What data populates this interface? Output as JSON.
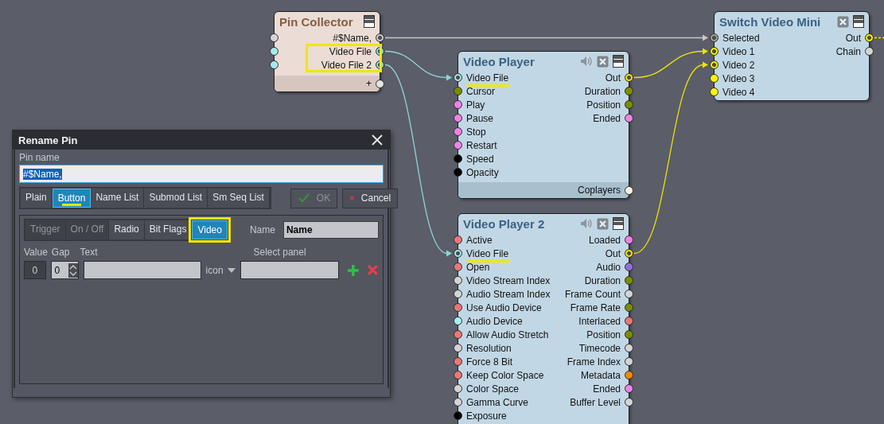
{
  "nodes": [
    {
      "kind": "collector",
      "title": "Pin Collector",
      "inputs": [
        {
          "color": "#d4d4d4",
          "connected": false
        },
        {
          "color": "#a4eaea",
          "connected": false
        },
        {
          "color": "#a4eaea",
          "connected": false
        }
      ],
      "outputs": [
        {
          "label": "#$Name,",
          "color": "#c8c8c8",
          "connected": true,
          "highlighted": false
        },
        {
          "label": "Video File",
          "color": "#8fd4d4",
          "connected": true,
          "highlighted": true
        },
        {
          "label": "Video File 2",
          "color": "#8fd4d4",
          "connected": true,
          "highlighted": true
        }
      ],
      "footer_outputs": [
        {
          "label": "+",
          "color": "#e4e4e4",
          "connected": false
        }
      ]
    },
    {
      "kind": "player",
      "title": "Video Player",
      "inputs": [
        {
          "label": "Video File",
          "color": "#a4e4e4",
          "connected": true,
          "highlighted": true
        },
        {
          "label": "Cursor",
          "color": "#7a8c00",
          "connected": false
        },
        {
          "label": "Play",
          "color": "#ee82e8",
          "connected": false
        },
        {
          "label": "Pause",
          "color": "#ee82e8",
          "connected": false
        },
        {
          "label": "Stop",
          "color": "#ee82e8",
          "connected": false
        },
        {
          "label": "Restart",
          "color": "#ee82e8",
          "connected": false
        },
        {
          "label": "Speed",
          "color": "#000000",
          "connected": false
        },
        {
          "label": "Opacity",
          "color": "#000000",
          "connected": false
        }
      ],
      "outputs": [
        {
          "label": "Out",
          "color": "#ece400",
          "connected": true
        },
        {
          "label": "Duration",
          "color": "#7a8c00",
          "connected": false
        },
        {
          "label": "Position",
          "color": "#7a8c00",
          "connected": false
        },
        {
          "label": "Ended",
          "color": "#ee82e8",
          "connected": false
        }
      ],
      "footer_outputs": [
        {
          "label": "Coplayers",
          "color": "#f6f4de",
          "connected": false
        }
      ]
    },
    {
      "kind": "player",
      "title": "Video Player 2",
      "inputs": [
        {
          "label": "Active",
          "color": "#ea7878",
          "connected": false
        },
        {
          "label": "Video File",
          "color": "#a4e4e4",
          "connected": true,
          "highlighted": true
        },
        {
          "label": "Open",
          "color": "#ea7878",
          "connected": false
        },
        {
          "label": "Video Stream Index",
          "color": "#d4d4d4",
          "connected": false
        },
        {
          "label": "Audio Stream Index",
          "color": "#d4d4d4",
          "connected": false
        },
        {
          "label": "Use Audio Device",
          "color": "#ea7878",
          "connected": false
        },
        {
          "label": "Audio Device",
          "color": "#a8eeee",
          "connected": false
        },
        {
          "label": "Allow Audio Stretch",
          "color": "#ea7878",
          "connected": false
        },
        {
          "label": "Resolution",
          "color": "#d4d4d4",
          "connected": false
        },
        {
          "label": "Force 8 Bit",
          "color": "#ea7878",
          "connected": false
        },
        {
          "label": "Keep Color Space",
          "color": "#ea7878",
          "connected": false
        },
        {
          "label": "Color Space",
          "color": "#d4d4d4",
          "connected": false
        },
        {
          "label": "Gamma Curve",
          "color": "#d4d4d4",
          "connected": false
        },
        {
          "label": "Exposure",
          "color": "#000000",
          "connected": false
        }
      ],
      "outputs": [
        {
          "label": "Loaded",
          "color": "#ee82e8",
          "connected": false
        },
        {
          "label": "Out",
          "color": "#ece400",
          "connected": true
        },
        {
          "label": "Audio",
          "color": "#9070d4",
          "connected": false
        },
        {
          "label": "Duration",
          "color": "#7a8c00",
          "connected": false
        },
        {
          "label": "Frame Count",
          "color": "#d4d4d4",
          "connected": false
        },
        {
          "label": "Frame Rate",
          "color": "#7a8c00",
          "connected": false
        },
        {
          "label": "Interlaced",
          "color": "#ea7878",
          "connected": false
        },
        {
          "label": "Position",
          "color": "#7a8c00",
          "connected": false
        },
        {
          "label": "Timecode",
          "color": "#d4d4d4",
          "connected": false
        },
        {
          "label": "Frame Index",
          "color": "#d4d4d4",
          "connected": false
        },
        {
          "label": "Metadata",
          "color": "#f08a00",
          "connected": false
        },
        {
          "label": "Ended",
          "color": "#ee82e8",
          "connected": false
        },
        {
          "label": "Buffer Level",
          "color": "#d4d4d4",
          "connected": false
        }
      ]
    },
    {
      "kind": "switch",
      "title": "Switch Video Mini",
      "inputs": [
        {
          "label": "Selected",
          "color": "#a0a0a0",
          "connected": true
        },
        {
          "label": "Video 1",
          "color": "#f0ec00",
          "connected": true
        },
        {
          "label": "Video 2",
          "color": "#f0ec00",
          "connected": true
        },
        {
          "label": "Video 3",
          "color": "#f8f400",
          "connected": false
        },
        {
          "label": "Video 4",
          "color": "#f8f400",
          "connected": false
        }
      ],
      "outputs": [
        {
          "label": "Out",
          "color": "#f0ec00",
          "connected": true
        },
        {
          "label": "Chain",
          "color": "#d4d4d4",
          "connected": false
        }
      ]
    }
  ],
  "dialog": {
    "title": "Rename Pin",
    "pin_name_label": "Pin name",
    "pin_name": "#$Name,",
    "pin_name_selected": true,
    "types": [
      {
        "label": "Plain",
        "selected": false,
        "highlighted": false
      },
      {
        "label": "Button",
        "selected": true,
        "highlighted": true
      },
      {
        "label": "Name List",
        "selected": false,
        "highlighted": false
      },
      {
        "label": "Submod List",
        "selected": false,
        "highlighted": false
      },
      {
        "label": "Sm Seq List",
        "selected": false,
        "highlighted": false
      }
    ],
    "ok": {
      "label": "OK",
      "disabled": true
    },
    "cancel": {
      "label": "Cancel"
    },
    "subtypes": [
      {
        "label": "Trigger",
        "selected": false,
        "disabled": true,
        "highlighted": false
      },
      {
        "label": "On / Off",
        "selected": false,
        "disabled": true,
        "highlighted": false
      },
      {
        "label": "Radio",
        "selected": false,
        "disabled": false,
        "highlighted": false
      },
      {
        "label": "Bit Flags",
        "selected": false,
        "disabled": false,
        "highlighted": false
      },
      {
        "label": "Video",
        "selected": true,
        "disabled": false,
        "highlighted": true
      }
    ],
    "name_label": "Name",
    "name_value": "Name",
    "value_label": "Value",
    "gap_label": "Gap",
    "text_label": "Text",
    "select_panel_label": "Select panel",
    "value": "0",
    "gap": "0",
    "icon_dropdown": "icon"
  }
}
